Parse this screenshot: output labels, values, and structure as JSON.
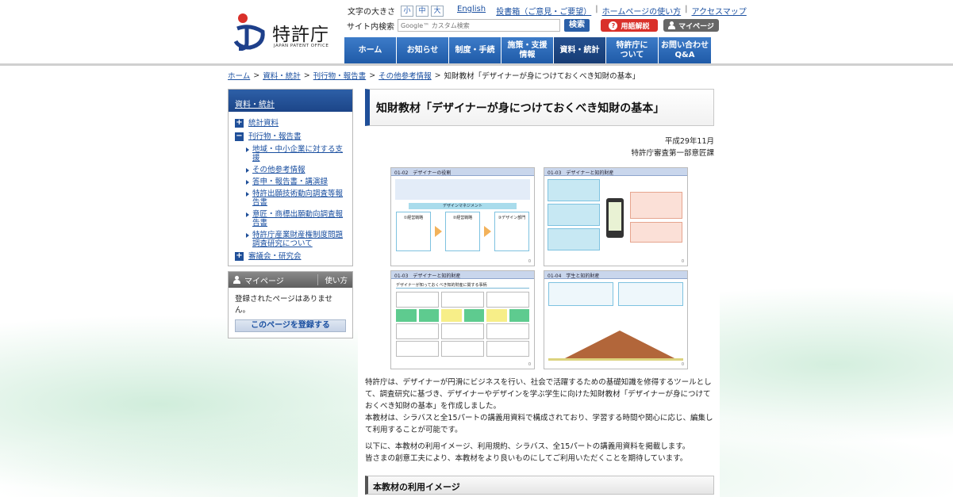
{
  "header": {
    "logo_text": "特許庁",
    "logo_sub": "JAPAN PATENT OFFICE",
    "font_size_label": "文字の大きさ",
    "font_sizes": [
      "小",
      "中",
      "大"
    ],
    "top_links": [
      "English",
      "投書箱（ご意見・ご要望）",
      "ホームページの使い方",
      "アクセスマップ"
    ],
    "search_label": "サイト内検索",
    "search_placeholder": "Google™ カスタム検索",
    "search_button": "検索",
    "glossary_button": "用語解説",
    "mypage_button": "マイページ",
    "nav": [
      {
        "label": "ホーム"
      },
      {
        "label": "お知らせ"
      },
      {
        "label": "制度・手続"
      },
      {
        "label": "施策・支援\n情報"
      },
      {
        "label": "資料・統計"
      },
      {
        "label": "特許庁に\nついて"
      },
      {
        "label": "お問い合わせ\nQ&A"
      }
    ]
  },
  "breadcrumb": {
    "items": [
      "ホーム",
      "資料・統計",
      "刊行物・報告書",
      "その他参考情報"
    ],
    "current": "知財教材「デザイナーが身につけておくべき知財の基本」"
  },
  "sidebar": {
    "head": "資料・統計",
    "sec1": "統計資料",
    "sec2": "刊行物・報告書",
    "subs": [
      "地域・中小企業に対する支援",
      "その他参考情報",
      "答申・報告書・講演録",
      "特許出願技術動向調査等報告書",
      "意匠・商標出願動向調査報告書",
      "特許庁産業財産権制度問題調査研究について"
    ],
    "sec3": "審議会・研究会",
    "mypage_title": "マイページ",
    "mypage_howto": "使い方",
    "mypage_empty": "登録されたページはありません。",
    "mypage_register": "このページを登録する"
  },
  "main": {
    "title": "知財教材「デザイナーが身につけておくべき知財の基本」",
    "date": "平成29年11月",
    "department": "特許庁審査第一部意匠課",
    "slides": [
      {
        "title": "01-02　デザイナーの役割",
        "band": "デザインマネジメント",
        "boxes": [
          "①経営戦略",
          "②経営戦略",
          "③デザイン部門"
        ],
        "page": "0"
      },
      {
        "title": "01-03　デザイナーと知的財産",
        "page": "0"
      },
      {
        "title": "01-03　デザイナーと知的財産",
        "caption": "デザイナーが知っておくべき知的財産に関する事柄",
        "page": "0"
      },
      {
        "title": "01-04　学生と知的財産",
        "page": "0"
      }
    ],
    "desc1": "特許庁は、デザイナーが円滑にビジネスを行い、社会で活躍するための基礎知識を修得するツールとして、調査研究に基づき、デザイナーやデザインを学ぶ学生に向けた知財教材「デザイナーが身につけておくべき知財の基本」を作成しました。",
    "desc2": "本教材は、シラバスと全15パートの講義用資料で構成されており、学習する時間や関心に応じ、編集して利用することが可能です。",
    "desc3": "以下に、本教材の利用イメージ、利用規約、シラバス、全15パートの講義用資料を掲載します。",
    "desc4": "皆さまの創意工夫により、本教材をより良いものにしてご利用いただくことを期待しています。",
    "section_head": "本教材の利用イメージ"
  }
}
